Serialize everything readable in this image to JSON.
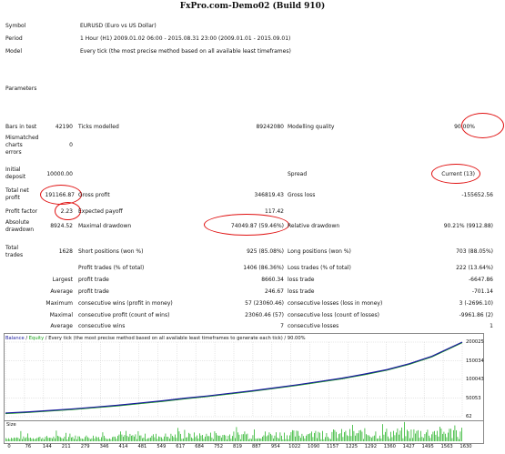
{
  "title": "FxPro.com-Demo02 (Build 910)",
  "header_rows": [
    {
      "label": "Symbol",
      "value": "EURUSD (Euro vs US Dollar)"
    },
    {
      "label": "Period",
      "value": "1 Hour (H1) 2009.01.02 06:00 - 2015.08.31 23:00 (2009.01.01 - 2015.09.01)"
    },
    {
      "label": "Model",
      "value": "Every tick (the most precise method based on all available least timeframes)"
    }
  ],
  "parameters_label": "Parameters",
  "bars": {
    "label": "Bars in test",
    "value": "42190",
    "ticks_label": "Ticks modelled",
    "ticks_value": "89242080",
    "quality_label": "Modelling quality",
    "quality_value": "90.00%"
  },
  "mismatched": {
    "label_1": "Mismatched",
    "label_2": "charts",
    "label_3": "errors",
    "value": "0"
  },
  "deposit": {
    "label_1": "Initial",
    "label_2": "deposit",
    "value": "10000.00",
    "spread_label": "Spread",
    "spread_value": "Current (13)"
  },
  "net_profit": {
    "label_1": "Total net",
    "label_2": "profit",
    "value": "191166.87",
    "gross_profit_label": "Gross profit",
    "gross_profit_value": "346819.43",
    "gross_loss_label": "Gross loss",
    "gross_loss_value": "-155652.56"
  },
  "profit_factor": {
    "label": "Profit factor",
    "value": "2.23",
    "payoff_label": "Expected payoff",
    "payoff_value": "117.42"
  },
  "drawdown": {
    "label_1": "Absolute",
    "label_2": "drawdown",
    "value": "8924.52",
    "maximal_label": "Maximal drawdown",
    "maximal_value": "74049.87 (59.46%)",
    "relative_label": "Relative drawdown",
    "relative_value": "90.21% (9912.88)"
  },
  "trades": {
    "label_1": "Total",
    "label_2": "trades",
    "value": "1628",
    "short_label": "Short positions (won %)",
    "short_value": "925 (85.08%)",
    "long_label": "Long positions (won %)",
    "long_value": "703 (88.05%)"
  },
  "profit_trades": {
    "label": "Profit trades (% of total)",
    "value": "1406 (86.36%)",
    "loss_label": "Loss trades (% of total)",
    "loss_value": "222 (13.64%)"
  },
  "largest": {
    "label": "Largest",
    "profit_label": "profit trade",
    "profit_value": "8660.34",
    "loss_label": "loss trade",
    "loss_value": "-6647.86"
  },
  "average": {
    "label": "Average",
    "profit_label": "profit trade",
    "profit_value": "246.67",
    "loss_label": "loss trade",
    "loss_value": "-701.14"
  },
  "maximum": {
    "label": "Maximum",
    "wins_label": "consecutive wins (profit in money)",
    "wins_value": "57 (23060.46)",
    "losses_label": "consecutive losses (loss in money)",
    "losses_value": "3 (-2696.10)"
  },
  "maximal": {
    "label": "Maximal",
    "wins_label": "consecutive profit (count of wins)",
    "wins_value": "23060.46 (57)",
    "losses_label": "consecutive loss (count of losses)",
    "losses_value": "-9961.86 (2)"
  },
  "avg_consec": {
    "label": "Average",
    "wins_label": "consecutive wins",
    "wins_value": "7",
    "losses_label": "consecutive losses",
    "losses_value": "1"
  },
  "chart_header": {
    "balance": "Balance",
    "separator": " / ",
    "equity": "Equity",
    "rest": " / Every tick (the most precise method based on all available least timeframes to generate each tick) / 90.00%"
  },
  "colors": {
    "balance": "#1a1a9e",
    "equity": "#16a016",
    "highlight": "#e01010",
    "size_bars": "#2db52d"
  },
  "chart_data": {
    "type": "line",
    "x": [
      0,
      80,
      160,
      240,
      320,
      400,
      480,
      560,
      640,
      720,
      800,
      880,
      960,
      1040,
      1120,
      1200,
      1280,
      1360,
      1440,
      1520,
      1628
    ],
    "series": [
      {
        "name": "Balance",
        "values": [
          10000,
          13000,
          17000,
          21000,
          26000,
          31000,
          37000,
          43000,
          50000,
          56000,
          63000,
          70000,
          78000,
          86000,
          95000,
          104000,
          115000,
          127000,
          143000,
          163000,
          201166
        ]
      }
    ],
    "y_ticks": [
      "200025",
      "150034",
      "100043",
      "50053",
      "62"
    ],
    "x_ticks": [
      "0",
      "76",
      "144",
      "211",
      "279",
      "346",
      "414",
      "481",
      "549",
      "617",
      "684",
      "752",
      "819",
      "887",
      "954",
      "1022",
      "1090",
      "1157",
      "1225",
      "1292",
      "1360",
      "1427",
      "1495",
      "1563",
      "1630"
    ],
    "ylim": [
      62,
      201166
    ],
    "size_label": "Size",
    "grid": true
  }
}
